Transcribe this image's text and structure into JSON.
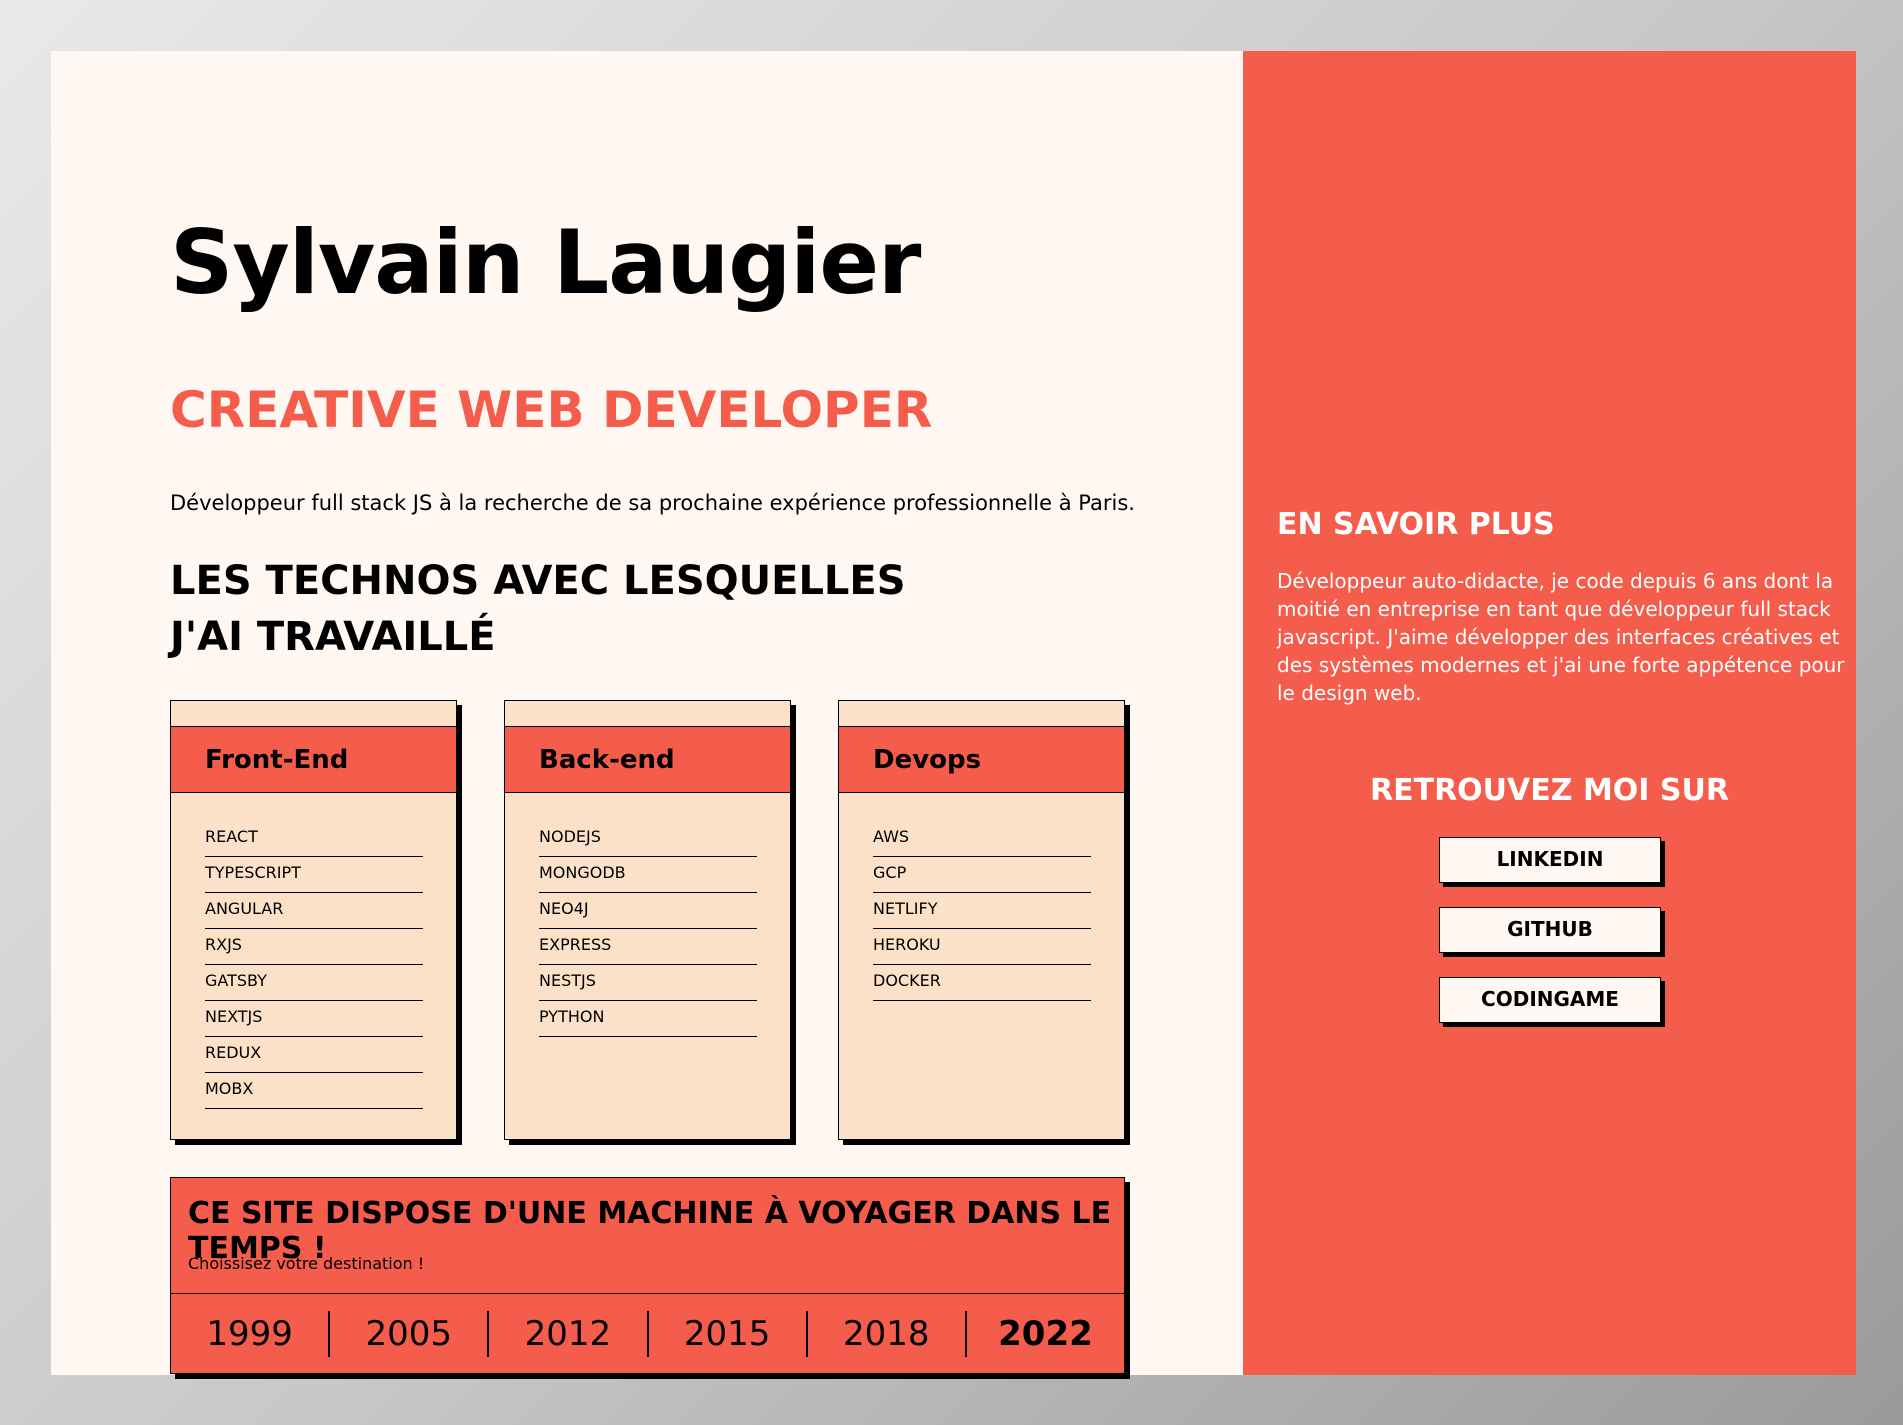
{
  "header": {
    "name": "Sylvain Laugier",
    "role": "CREATIVE WEB DEVELOPER",
    "intro": "Développeur full stack JS à la recherche de sa prochaine expérience professionnelle à Paris."
  },
  "techs": {
    "title": "LES TECHNOS AVEC LESQUELLES J'AI TRAVAILLÉ",
    "cards": [
      {
        "title": "Front-End",
        "items": [
          "REACT",
          "TYPESCRIPT",
          "ANGULAR",
          "RXJS",
          "GATSBY",
          "NEXTJS",
          "REDUX",
          "MOBX"
        ]
      },
      {
        "title": "Back-end",
        "items": [
          "NODEJS",
          "MONGODB",
          "NEO4J",
          "EXPRESS",
          "NESTJS",
          "PYTHON"
        ]
      },
      {
        "title": "Devops",
        "items": [
          "AWS",
          "GCP",
          "NETLIFY",
          "HEROKU",
          "DOCKER"
        ]
      }
    ]
  },
  "travel": {
    "title": "CE SITE DISPOSE D'UNE MACHINE À VOYAGER DANS LE TEMPS !",
    "subtitle": "Choissisez votre destination !",
    "years": [
      "1999",
      "2005",
      "2012",
      "2015",
      "2018",
      "2022"
    ],
    "active_year": "2022"
  },
  "side": {
    "title": "EN SAVOIR PLUS",
    "text": "Développeur auto-didacte, je code depuis 6 ans dont la moitié en entreprise en tant que développeur full stack javascript. J'aime développer des interfaces créatives et des systèmes modernes et j'ai une forte appétence pour le design web.",
    "find_title": "RETROUVEZ MOI SUR",
    "links": [
      "LINKEDIN",
      "GITHUB",
      "CODINGAME"
    ]
  },
  "colors": {
    "accent": "#f45c4b",
    "card_bg": "#fae1c7",
    "page_bg": "#fff8f2"
  }
}
